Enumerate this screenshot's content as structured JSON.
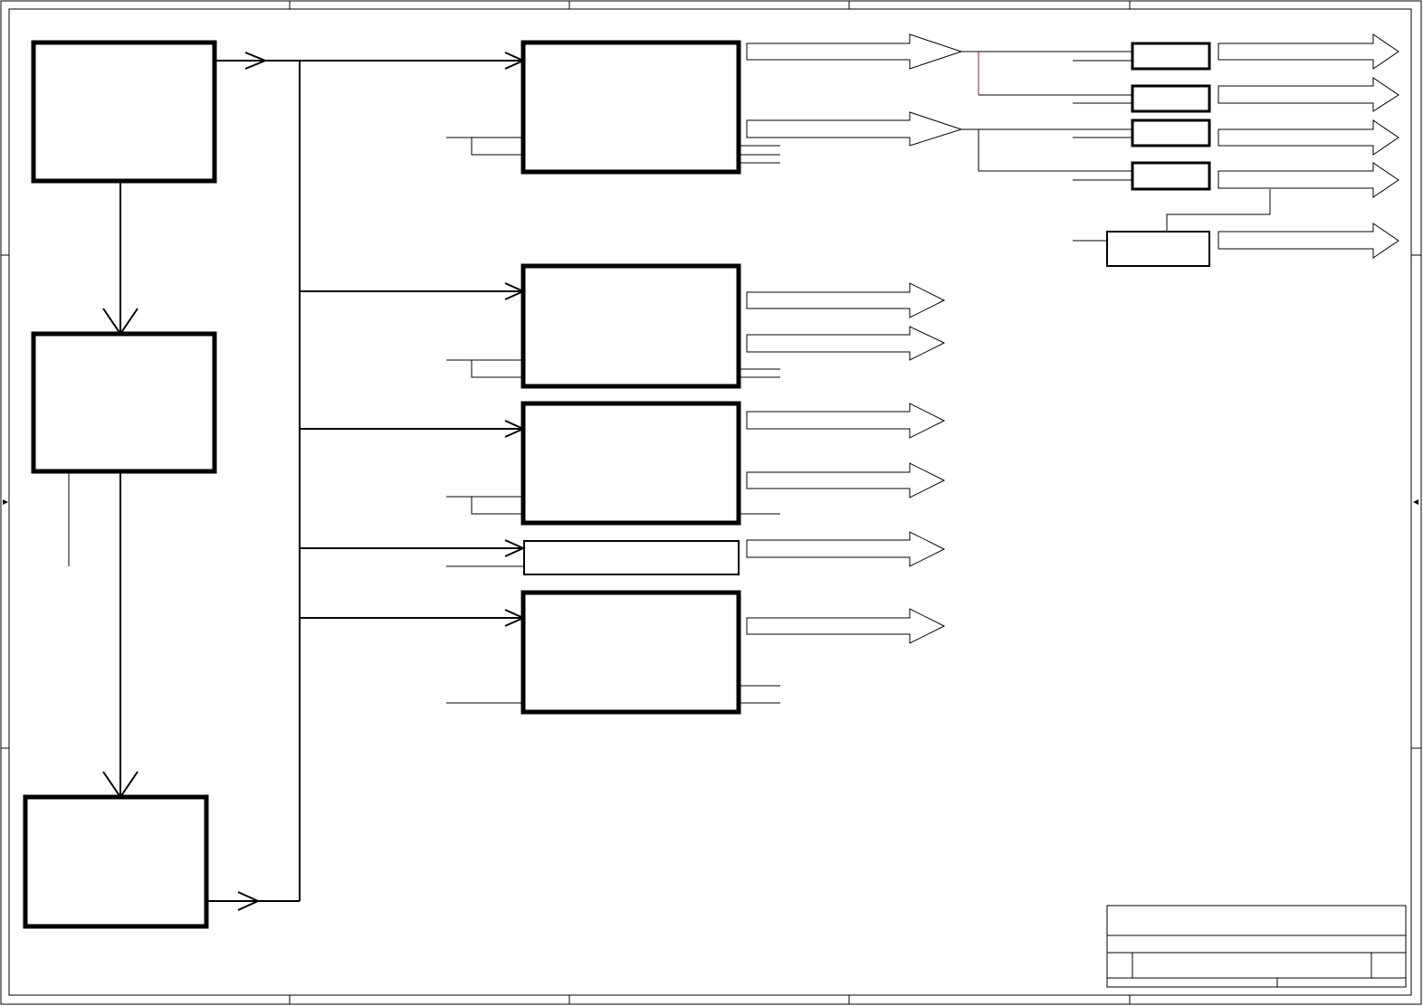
{
  "diagram": {
    "type": "block-diagram",
    "description_visible_text": []
  },
  "colors": {
    "line": "#000000",
    "accent_connector": "#8b1a4a",
    "background": "#ffffff"
  },
  "title_block": {
    "cells": []
  }
}
